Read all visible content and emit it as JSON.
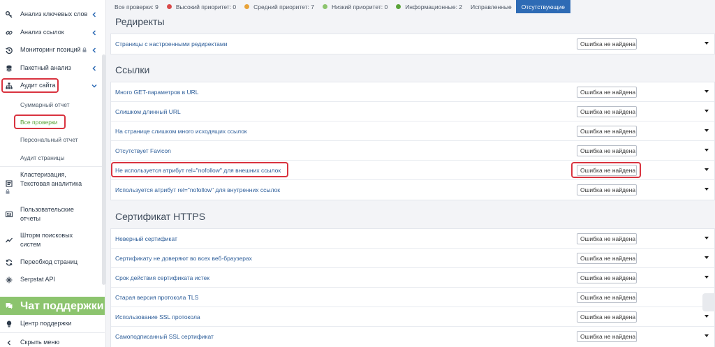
{
  "sidebar": {
    "items": [
      {
        "label": "Анализ ключевых слов",
        "icon": "key-icon"
      },
      {
        "label": "Анализ ссылок",
        "icon": "link-icon"
      },
      {
        "label": "Мониторинг позиций",
        "icon": "history-icon"
      },
      {
        "label": "Пакетный анализ",
        "icon": "database-icon"
      },
      {
        "label": "Аудит сайта",
        "icon": "sitemap-icon"
      }
    ],
    "audit_subitems": [
      "Суммарный отчет",
      "Все проверки",
      "Персональный отчет",
      "Аудит страницы"
    ],
    "clustering_line1": "Кластеризация,",
    "clustering_line2": "Текстовая аналитика",
    "user_reports_line1": "Пользовательские",
    "user_reports_line2": "отчеты",
    "storm_line1": "Шторм поисковых",
    "storm_line2": "систем",
    "recrawl": "Переобход страниц",
    "api": "Serpstat API",
    "support_chat": "Чат поддержки",
    "support_center": "Центр поддержки",
    "hide_menu": "Скрыть меню"
  },
  "tabs": [
    {
      "label": "Все проверки: 9"
    },
    {
      "label": "Высокий приоритет: 0",
      "dot_color": "#d94a4a"
    },
    {
      "label": "Средний приоритет: 7",
      "dot_color": "#e8a33a"
    },
    {
      "label": "Низкий приоритет: 0",
      "dot_color": "#8cc46e"
    },
    {
      "label": "Информационные: 2",
      "dot_color": "#5aa339"
    },
    {
      "label": "Исправленные"
    },
    {
      "label": "Отсутствующие",
      "active": true
    }
  ],
  "sections": [
    {
      "title": "Редиректы",
      "rows": [
        "Страницы с настроенными редиректами"
      ]
    },
    {
      "title": "Ссылки",
      "rows": [
        "Много GET-параметров в URL",
        "Слишком длинный URL",
        "На странице слишком много исходящих ссылок",
        "Отсутствует Favicon",
        "Не используется атрибут rel=\"nofollow\" для внешних ссылок",
        "Используется атрибут rel=\"nofollow\" для внутренних ссылок"
      ]
    },
    {
      "title": "Сертификат HTTPS",
      "rows": [
        "Неверный сертификат",
        "Сертификату не доверяют во всех веб-браузерах",
        "Срок действия сертификата истек",
        "Старая версия протокола TLS",
        "Использование SSL протокола",
        "Самоподписанный SSL сертификат"
      ]
    }
  ],
  "status_value": "Ошибка не найдена",
  "colors": {
    "accent_blue": "#2e6bb5",
    "link_blue": "#2c5d99",
    "active_green": "#5aa339",
    "support_green": "#8cc46e",
    "highlight_red": "#d9333f"
  }
}
